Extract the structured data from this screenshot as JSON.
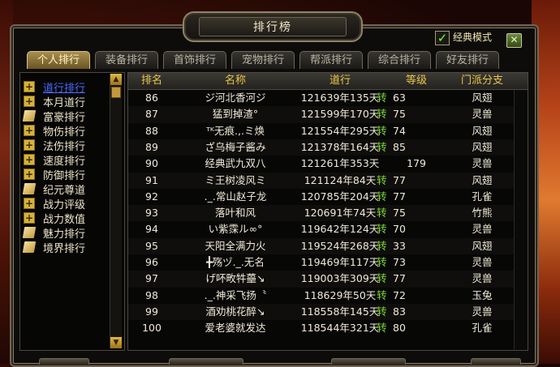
{
  "window": {
    "title": "排行榜"
  },
  "options": {
    "classic_mode_label": "经典模式",
    "classic_mode_checked": true,
    "close_label": "✕"
  },
  "tabs": [
    "个人排行",
    "装备排行",
    "首饰排行",
    "宠物排行",
    "帮派排行",
    "综合排行",
    "好友排行"
  ],
  "active_tab": 0,
  "categories": [
    {
      "label": "道行排行",
      "icon": "plus-icon",
      "active": true
    },
    {
      "label": "本月道行",
      "icon": "plus-icon"
    },
    {
      "label": "富豪排行",
      "icon": "book-icon"
    },
    {
      "label": "物伤排行",
      "icon": "plus-icon"
    },
    {
      "label": "法伤排行",
      "icon": "plus-icon"
    },
    {
      "label": "速度排行",
      "icon": "plus-icon"
    },
    {
      "label": "防御排行",
      "icon": "plus-icon"
    },
    {
      "label": "纪元尊道",
      "icon": "book-icon"
    },
    {
      "label": "战力评级",
      "icon": "plus-icon"
    },
    {
      "label": "战力数值",
      "icon": "plus-icon"
    },
    {
      "label": "魅力排行",
      "icon": "book-icon"
    },
    {
      "label": "境界排行",
      "icon": "book-icon"
    }
  ],
  "table": {
    "headers": [
      "排名",
      "名称",
      "道行",
      "等级",
      "门派分支"
    ],
    "tier_glyph": "转",
    "rows": [
      {
        "rank": "86",
        "name": "ジ河北香河ジ",
        "daoxing": "121639年135天",
        "tier": true,
        "level": "63",
        "faction": "风翅"
      },
      {
        "rank": "87",
        "name": "猛到掉渣°",
        "daoxing": "121599年170天",
        "tier": true,
        "level": "75",
        "faction": "灵兽"
      },
      {
        "rank": "88",
        "name": "ᵀᴷ无痕.,.ミ焕",
        "daoxing": "121554年295天",
        "tier": true,
        "level": "74",
        "faction": "风翅"
      },
      {
        "rank": "89",
        "name": "ざ乌梅子酱み",
        "daoxing": "121378年164天",
        "tier": true,
        "level": "85",
        "faction": "风翅"
      },
      {
        "rank": "90",
        "name": "经典武九双八",
        "daoxing": "121261年353天",
        "tier": false,
        "level": "179",
        "faction": "灵兽"
      },
      {
        "rank": "91",
        "name": "ミ王树凌风ミ",
        "daoxing": "121124年84天",
        "tier": true,
        "level": "77",
        "faction": "风翅"
      },
      {
        "rank": "92",
        "name": "._.常山赵子龙",
        "daoxing": "120785年204天",
        "tier": true,
        "level": "77",
        "faction": "孔雀"
      },
      {
        "rank": "93",
        "name": "落叶和风",
        "daoxing": "120691年74天",
        "tier": true,
        "level": "75",
        "faction": "竹熊"
      },
      {
        "rank": "94",
        "name": "い紫霂ル∞°",
        "daoxing": "119642年124天",
        "tier": true,
        "level": "70",
        "faction": "灵兽"
      },
      {
        "rank": "95",
        "name": "天阳全满力火",
        "daoxing": "119524年268天",
        "tier": true,
        "level": "33",
        "faction": "风翅"
      },
      {
        "rank": "96",
        "name": "╋殇ヅ._.无名",
        "daoxing": "119469年117天",
        "tier": true,
        "level": "73",
        "faction": "灵兽"
      },
      {
        "rank": "97",
        "name": "げ吥畋牪蘲↘",
        "daoxing": "119003年309天",
        "tier": true,
        "level": "77",
        "faction": "灵兽"
      },
      {
        "rank": "98",
        "name": "._.神采飞扬〝",
        "daoxing": "118629年50天",
        "tier": true,
        "level": "72",
        "faction": "玉兔"
      },
      {
        "rank": "99",
        "name": "酒劝桃花醉↘",
        "daoxing": "118558年145天",
        "tier": true,
        "level": "83",
        "faction": "灵兽"
      },
      {
        "rank": "100",
        "name": "爱老婆就发达",
        "daoxing": "118544年321天",
        "tier": true,
        "level": "80",
        "faction": "孔雀"
      }
    ]
  },
  "colors": {
    "header_text": "#e8c64a",
    "active_category": "#4a6aff",
    "tier_glyph": "#7fd63a"
  }
}
